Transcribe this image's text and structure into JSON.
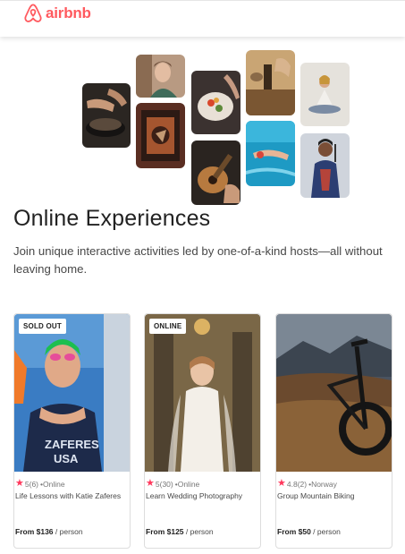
{
  "header": {
    "logo_text": "airbnb"
  },
  "hero": {
    "title": "Online Experiences",
    "subtitle": "Join unique interactive activities led by one-of-a-kind hosts—all without leaving home."
  },
  "cards": [
    {
      "badge": "SOLD OUT",
      "rating": "5",
      "reviews": "(6)",
      "location": "•Online",
      "title": "Life Lessons with Katie Zaferes",
      "price": "From $136",
      "unit": " / person"
    },
    {
      "badge": "ONLINE",
      "rating": "5",
      "reviews": "(30)",
      "location": "•Online",
      "title": "Learn Wedding Photography",
      "price": "From $125",
      "unit": " / person"
    },
    {
      "badge": "",
      "rating": "4.8",
      "reviews": "(2)",
      "location": "•Norway",
      "title": "Group Mountain Biking",
      "price": "From $50",
      "unit": " / person"
    }
  ],
  "icons": {
    "logo": "airbnb-logo-icon",
    "star": "star-icon"
  },
  "colors": {
    "brand": "#ff5a5f",
    "star": "#ff385c"
  }
}
